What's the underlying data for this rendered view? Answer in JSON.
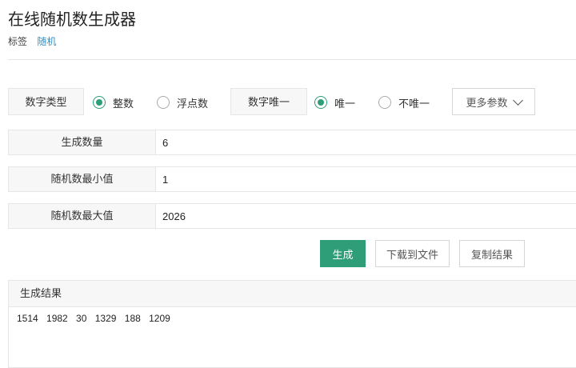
{
  "header": {
    "title": "在线随机数生成器",
    "tags_label": "标签",
    "tag": "随机"
  },
  "options": {
    "number_type_label": "数字类型",
    "integer_label": "整数",
    "float_label": "浮点数",
    "integer_selected": true,
    "unique_label": "数字唯一",
    "unique_yes_label": "唯一",
    "unique_no_label": "不唯一",
    "unique_yes_selected": true,
    "more_params_label": "更多参数"
  },
  "fields": {
    "count": {
      "label": "生成数量",
      "value": "6"
    },
    "min": {
      "label": "随机数最小值",
      "value": "1"
    },
    "max": {
      "label": "随机数最大值",
      "value": "2026"
    }
  },
  "actions": {
    "generate": "生成",
    "download": "下载到文件",
    "copy": "复制结果"
  },
  "result": {
    "title": "生成结果",
    "text": "1514 1982 30 1329 188 1209"
  },
  "colors": {
    "accent": "#2e9e78",
    "link": "#2a91c9"
  },
  "icons": {
    "more_params": "chevron-down-icon"
  }
}
